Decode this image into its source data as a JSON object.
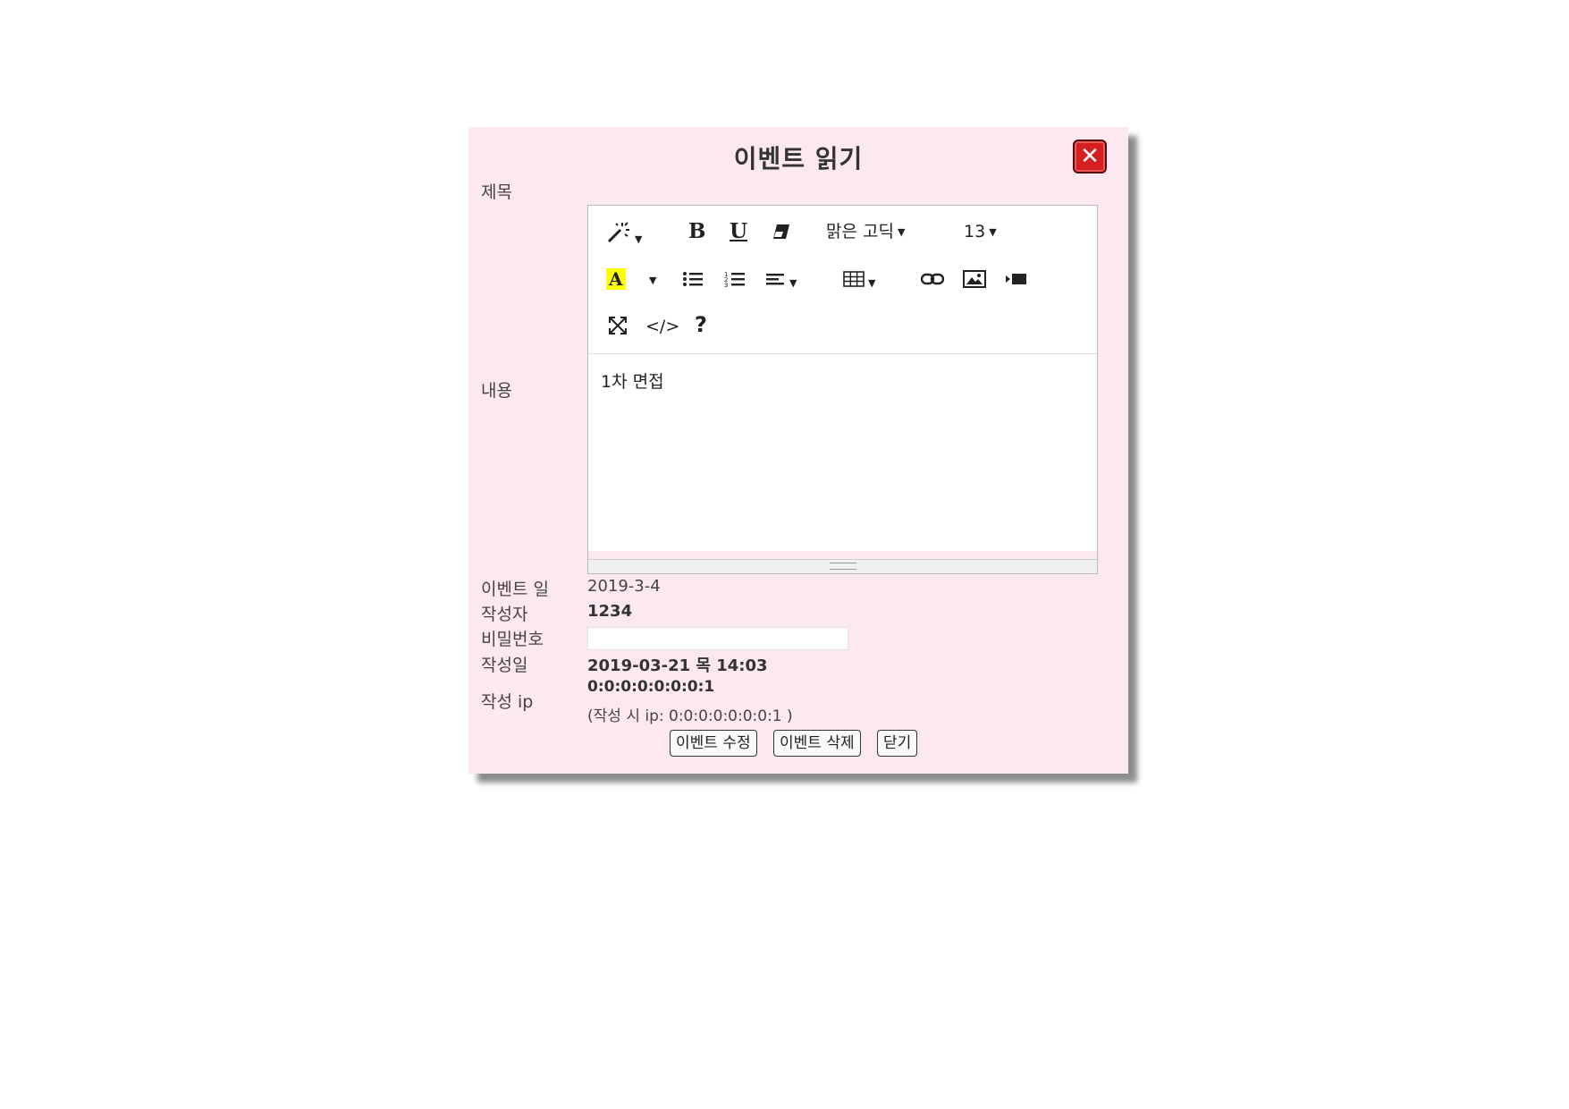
{
  "dialog": {
    "title": "이벤트 읽기",
    "close_glyph": "✕"
  },
  "labels": {
    "subject": "제목",
    "content": "내용",
    "event_date": "이벤트 일",
    "author": "작성자",
    "password": "비밀번호",
    "created": "작성일",
    "ip": "작성 ip"
  },
  "editor": {
    "toolbar": {
      "style_icon": "magic-wand-icon",
      "bold": "B",
      "underline": "U",
      "eraser_icon": "eraser-icon",
      "font_name": "맑은 고딕",
      "font_size": "13",
      "color_letter": "A",
      "ul_icon": "unordered-list-icon",
      "ol_icon": "ordered-list-icon",
      "align_icon": "align-icon",
      "table_icon": "table-icon",
      "link_icon": "link-icon",
      "picture_icon": "picture-icon",
      "video_icon": "video-icon",
      "fullscreen_icon": "fullscreen-icon",
      "codeview": "</>",
      "help": "?"
    },
    "content": "1차 면접"
  },
  "fields": {
    "event_date": "2019-3-4",
    "author": "1234",
    "password_value": "",
    "created": "2019-03-21 목 14:03",
    "ip": "0:0:0:0:0:0:0:1",
    "ip_note": "(작성 시 ip: 0:0:0:0:0:0:0:1 )"
  },
  "buttons": {
    "edit": "이벤트 수정",
    "delete": "이벤트 삭제",
    "close": "닫기"
  },
  "colors": {
    "dialog_bg": "#fbe9ef",
    "close_red": "#d42020",
    "highlight_yellow": "#ffff00"
  }
}
